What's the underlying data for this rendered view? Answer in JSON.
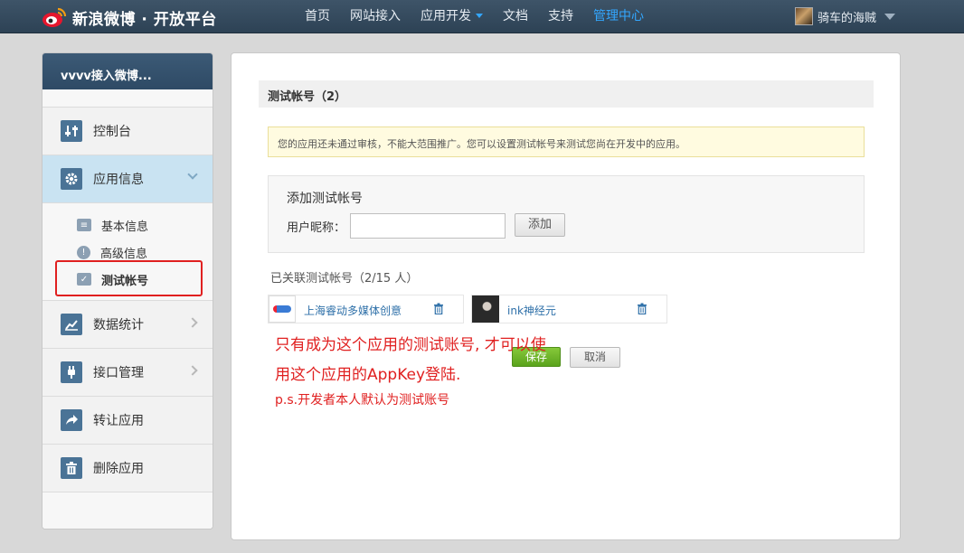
{
  "header": {
    "logo_text": "新浪微博 · 开放平台",
    "nav": [
      {
        "label": "首页"
      },
      {
        "label": "网站接入"
      },
      {
        "label": "应用开发"
      },
      {
        "label": "文档"
      },
      {
        "label": "支持"
      },
      {
        "label": "管理中心",
        "active": true
      }
    ],
    "user_name": "骑车的海贼",
    "accent_color": "#33a7ff"
  },
  "sidebar": {
    "app_title": "vvvv接入微博...",
    "items": [
      {
        "label": "控制台",
        "icon": "sliders-icon"
      },
      {
        "label": "应用信息",
        "icon": "gear-icon",
        "expanded": true
      },
      {
        "label": "数据统计",
        "icon": "line-chart-icon"
      },
      {
        "label": "接口管理",
        "icon": "plug-icon"
      },
      {
        "label": "转让应用",
        "icon": "share-arrow-icon"
      },
      {
        "label": "删除应用",
        "icon": "trash-icon"
      }
    ],
    "sub_items": [
      {
        "label": "基本信息",
        "icon": "id-card-icon"
      },
      {
        "label": "高级信息",
        "icon": "info-icon"
      },
      {
        "label": "测试帐号",
        "icon": "user-check-icon",
        "selected": true
      }
    ]
  },
  "main": {
    "section_title": "测试帐号（2）",
    "notice": "您的应用还未通过审核，不能大范围推广。您可以设置测试帐号来测试您尚在开发中的应用。",
    "add_box": {
      "title": "添加测试帐号",
      "nickname_label": "用户昵称：",
      "nickname_value": "",
      "add_button": "添加"
    },
    "linked_label": "已关联测试帐号（2/15 人）",
    "accounts": [
      {
        "name": "上海睿动多媒体创意"
      },
      {
        "name": "ink神经元"
      }
    ],
    "save_button": "保存",
    "cancel_button": "取消"
  },
  "annotation": {
    "line1": "只有成为这个应用的测试账号, 才可以使",
    "line2": "用这个应用的AppKey登陆.",
    "line3": "p.s.开发者本人默认为测试账号",
    "color": "#e02020"
  }
}
